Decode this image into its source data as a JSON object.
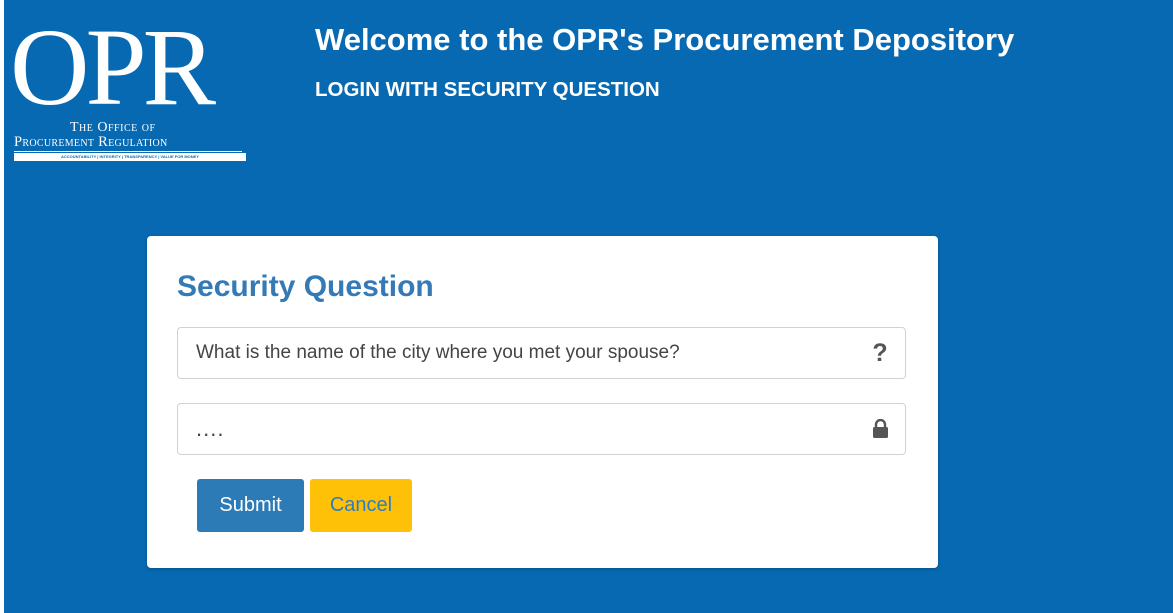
{
  "colors": {
    "banner_background": "#0769b1",
    "card_title": "#337ab7",
    "submit_button": "#2d7bb6",
    "cancel_button": "#ffc107"
  },
  "logo": {
    "letters": "OPR",
    "line1": "The Office of",
    "line2": "Procurement Regulation",
    "tagline": "ACCOUNTABILITY | INTEGRITY | TRANSPARENCY | VALUE FOR MONEY"
  },
  "header": {
    "title": "Welcome to the OPR's Procurement Depository",
    "subtitle": "LOGIN WITH SECURITY QUESTION"
  },
  "form": {
    "title": "Security Question",
    "question_value": "What is the name of the city where you met your spouse?",
    "question_icon": "question-mark-icon",
    "answer_value": "....",
    "answer_icon": "lock-icon",
    "submit_label": "Submit",
    "cancel_label": "Cancel"
  }
}
